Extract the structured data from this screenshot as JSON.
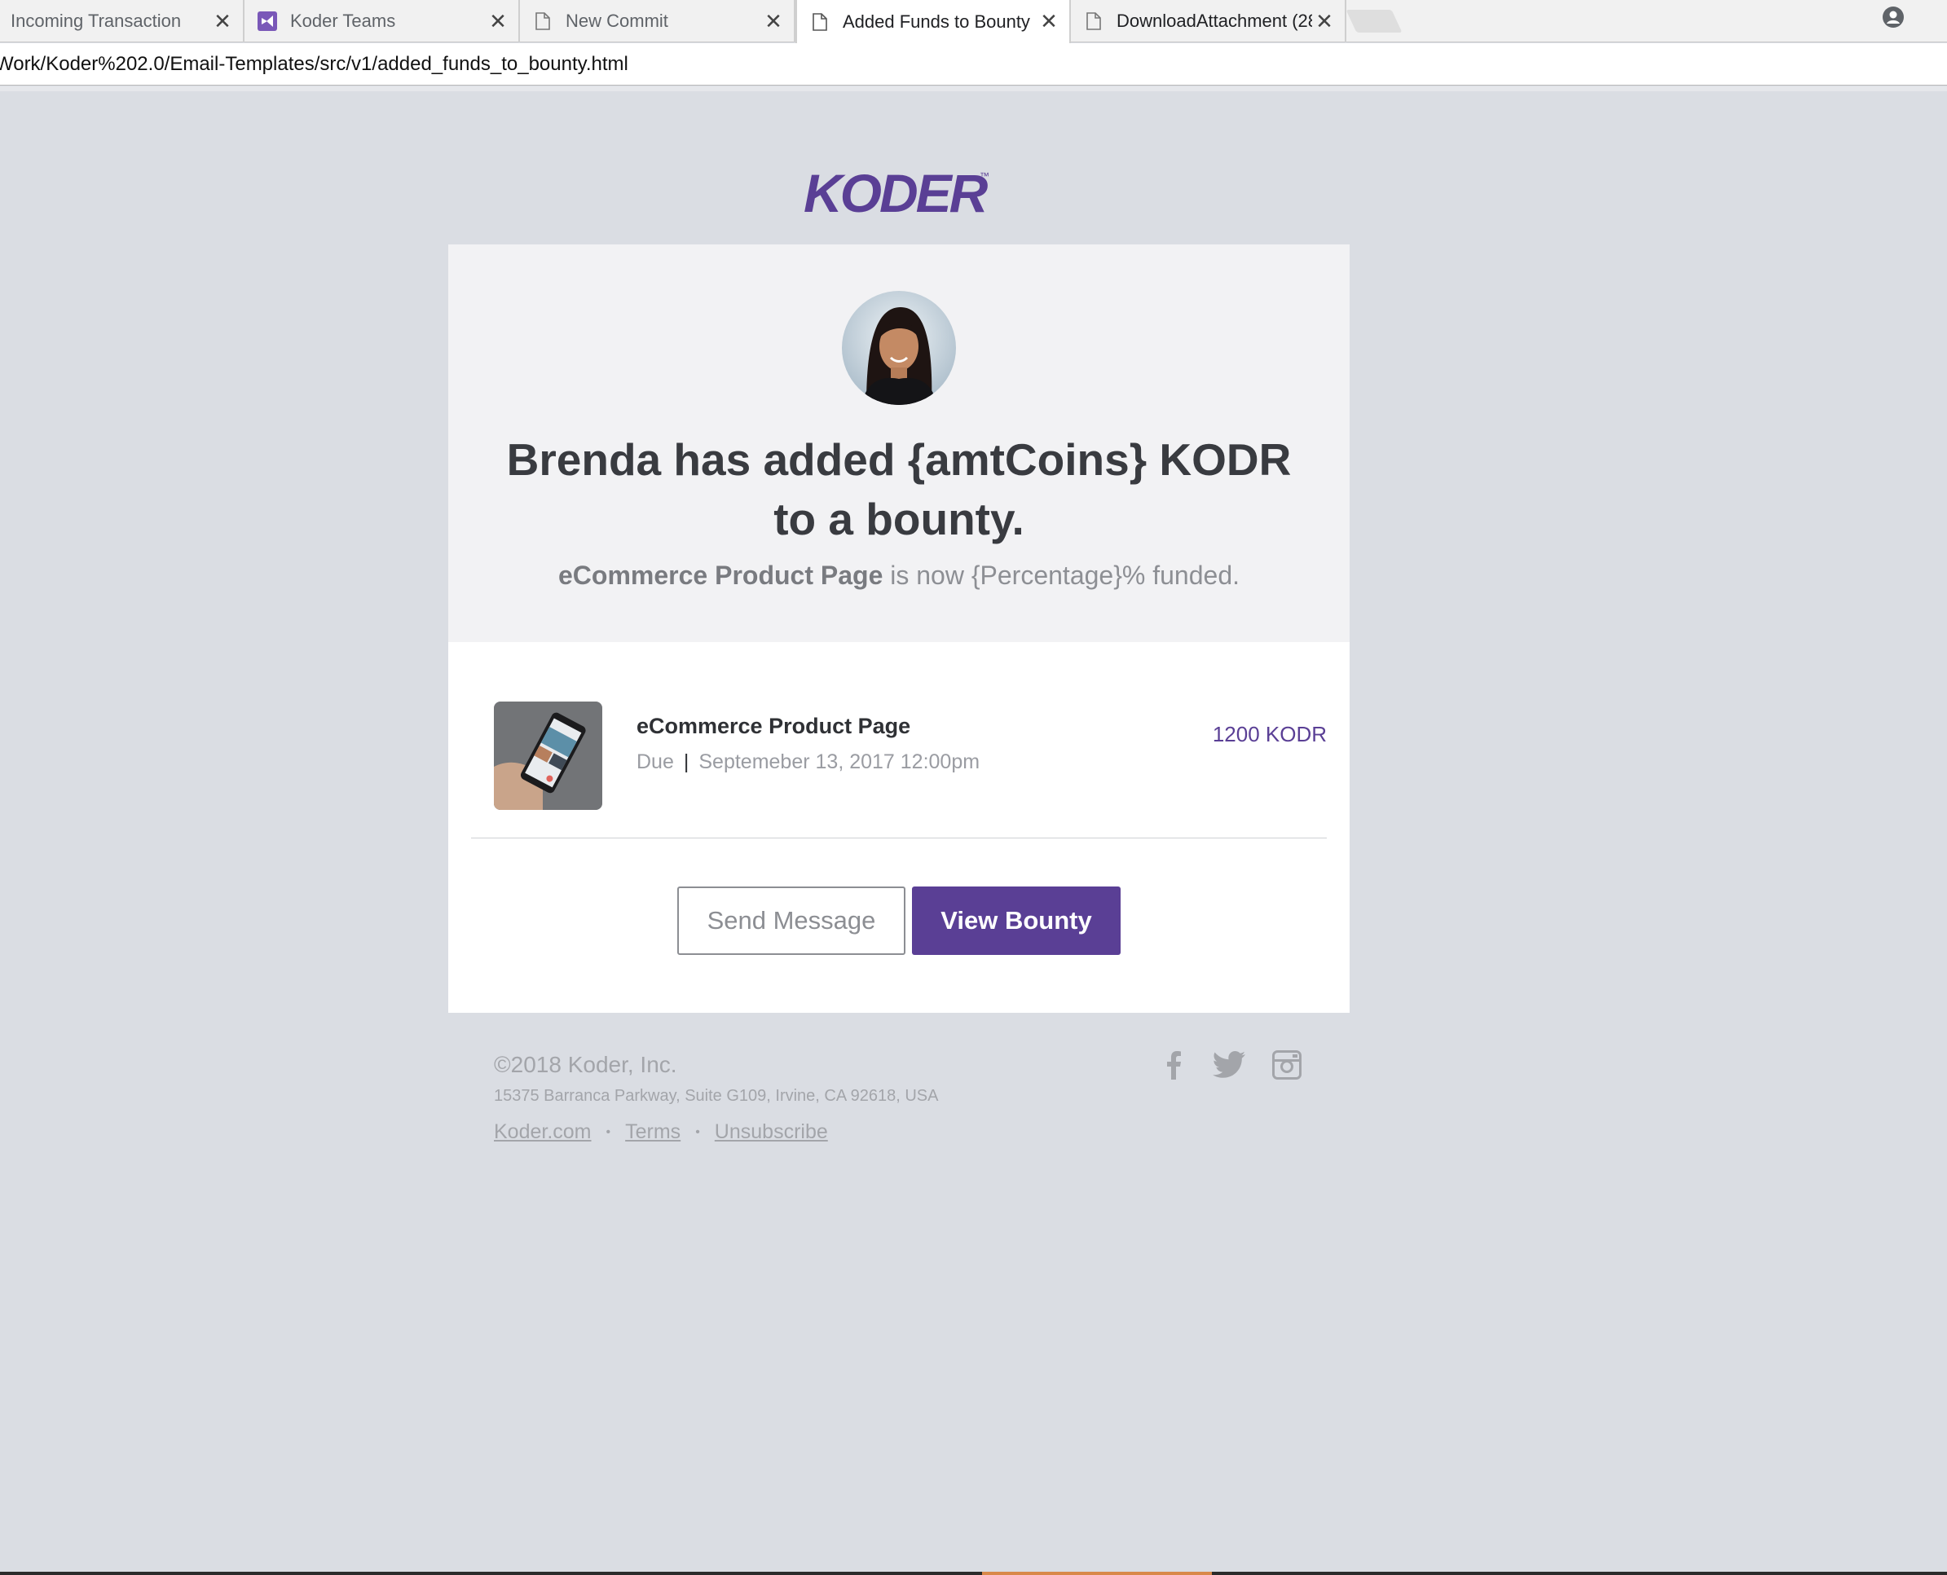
{
  "browser": {
    "tabs": [
      {
        "title": "Incoming Transaction",
        "icon": "none",
        "active": false
      },
      {
        "title": "Koder Teams",
        "icon": "visual-studio-icon",
        "active": false
      },
      {
        "title": "New Commit",
        "icon": "page-icon",
        "active": false
      },
      {
        "title": "Added Funds to Bounty",
        "icon": "page-icon",
        "active": true
      },
      {
        "title": "DownloadAttachment (28",
        "icon": "page-icon",
        "active": false
      }
    ],
    "close_glyph": "✕",
    "url": "Work/Koder%202.0/Email-Templates/src/v1/added_funds_to_bounty.html"
  },
  "email": {
    "logo_text": "KODER",
    "headline": "Brenda has added {amtCoins} KODR to a bounty.",
    "subline_project": "eCommerce Product Page",
    "subline_rest": " is now {Percentage}% funded.",
    "item": {
      "title": "eCommerce Product Page",
      "due_label": "Due",
      "due_separator": "|",
      "due_date": "Septemeber 13, 2017 12:00pm",
      "amount": "1200 KODR"
    },
    "buttons": {
      "send_message": "Send Message",
      "view_bounty": "View Bounty"
    }
  },
  "footer": {
    "copyright": "©2018 Koder, Inc.",
    "address": "15375 Barranca Parkway, Suite G109, Irvine, CA 92618, USA",
    "links": [
      "Koder.com",
      "Terms",
      "Unsubscribe"
    ],
    "link_separator": "•",
    "social_icons": [
      "facebook-icon",
      "twitter-icon",
      "instagram-icon"
    ]
  },
  "colors": {
    "brand_purple": "#5a3f95",
    "page_background": "#dadde3",
    "card_top_background": "#f2f2f4",
    "footer_text": "#a3a5aa"
  }
}
